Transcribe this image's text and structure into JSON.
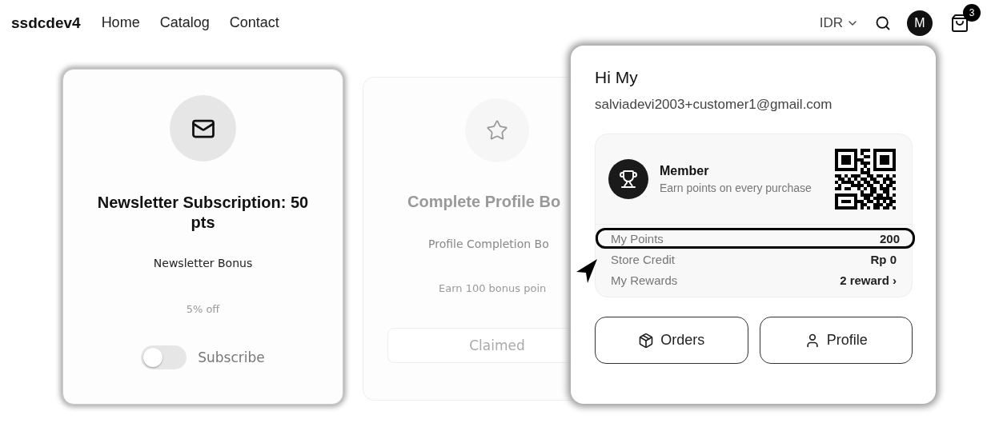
{
  "header": {
    "brand": "ssdcdev4",
    "nav": [
      {
        "label": "Home"
      },
      {
        "label": "Catalog"
      },
      {
        "label": "Contact"
      }
    ],
    "currency": "IDR",
    "avatar": "M",
    "cart_count": "3"
  },
  "cards": [
    {
      "kind": "toggle",
      "disabled": false,
      "title": "Newsletter Subscription: 50 pts",
      "subtitle": "Newsletter Bonus",
      "detail": "5% off",
      "toggle": {
        "label": "Subscribe",
        "on": false
      }
    },
    {
      "kind": "button",
      "disabled": true,
      "title": "Complete Profile Bo",
      "subtitle": "Profile Completion Bo",
      "detail": "Earn 100 bonus poin",
      "button": "Claimed"
    }
  ],
  "account_menu": {
    "greeting": "Hi My",
    "email": "salviadevi2003+customer1@gmail.com",
    "tier": "Member",
    "tier_note": "Earn points on every purchase",
    "stats": [
      {
        "label": "My Points",
        "value": "200",
        "highlighted": true
      },
      {
        "label": "Store Credit",
        "value": "Rp 0",
        "highlighted": false
      },
      {
        "label": "My Rewards",
        "value": "2 reward ›",
        "highlighted": false
      }
    ],
    "buttons": [
      {
        "kind": "orders",
        "label": "Orders"
      },
      {
        "kind": "profile",
        "label": "Profile"
      }
    ]
  }
}
